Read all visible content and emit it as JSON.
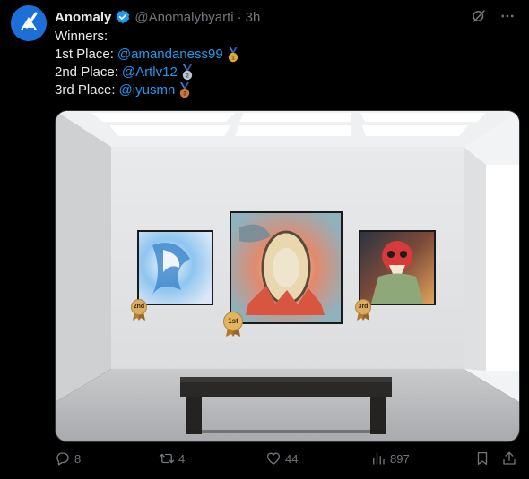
{
  "tweet": {
    "author_name": "Anomaly",
    "handle": "@Anomalybyarti",
    "separator": "·",
    "time": "3h",
    "lines": {
      "winners": "Winners:",
      "first_label": "1st Place:",
      "first_handle": "@amandaness99",
      "second_label": "2nd Place:",
      "second_handle": "@Artlv12",
      "third_label": "3rd Place:",
      "third_handle": "@iyusmn"
    }
  },
  "media": {
    "badges": {
      "first": "1st",
      "second": "2nd",
      "third": "3rd"
    }
  },
  "actions": {
    "replies": "8",
    "reposts": "4",
    "likes": "44",
    "views": "897"
  },
  "colors": {
    "link": "#1d9bf0",
    "muted": "#71767b",
    "verified": "#1d9bf0",
    "avatar_bg": "#1d6fd8",
    "gold": "#e0a63a",
    "silver": "#b9c3cc",
    "bronze": "#c9793e"
  },
  "icons": [
    "verified-badge-icon",
    "grok-icon",
    "more-icon",
    "reply-icon",
    "repost-icon",
    "like-icon",
    "views-icon",
    "bookmark-icon",
    "share-icon"
  ]
}
